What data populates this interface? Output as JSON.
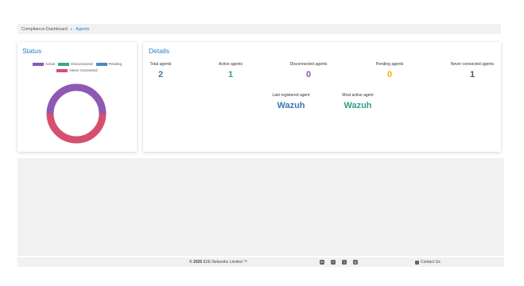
{
  "breadcrumb": {
    "root": "Compliance-Dashboard",
    "separator": "▸",
    "current": "Agents"
  },
  "status": {
    "title": "Status",
    "legend": [
      {
        "label": "Active",
        "color": "#8e59b3"
      },
      {
        "label": "Disconnected",
        "color": "#3fa591"
      },
      {
        "label": "Pending",
        "color": "#4a8bc0"
      },
      {
        "label": "Never Connected",
        "color": "#d5506f"
      }
    ],
    "chart_data": {
      "type": "pie",
      "categories": [
        "Active",
        "Disconnected",
        "Pending",
        "Never Connected"
      ],
      "values": [
        1,
        0,
        0,
        1
      ]
    }
  },
  "details": {
    "title": "Details",
    "stats": [
      {
        "label": "Total agents",
        "value": "2",
        "color": "#3a78b0"
      },
      {
        "label": "Active agents",
        "value": "1",
        "color": "#2f9f8a"
      },
      {
        "label": "Disconnected agents",
        "value": "0",
        "color": "#8e59b3"
      },
      {
        "label": "Pending agents",
        "value": "0",
        "color": "#f5b400"
      },
      {
        "label": "Never connected agents",
        "value": "1",
        "color": "#555555"
      }
    ],
    "last_registered": {
      "label": "Last registered agent",
      "value": "Wazuh",
      "color": "#3a78b0"
    },
    "most_active": {
      "label": "Most active agent",
      "value": "Wazuh",
      "color": "#2f9f8a"
    }
  },
  "footer": {
    "copyright_prefix": "© 2025",
    "copyright_rest": " E2E Networks Limited ™",
    "socials": [
      "linkedin-icon",
      "facebook-icon",
      "twitter-icon",
      "github-icon"
    ],
    "contact": "Contact Us"
  }
}
